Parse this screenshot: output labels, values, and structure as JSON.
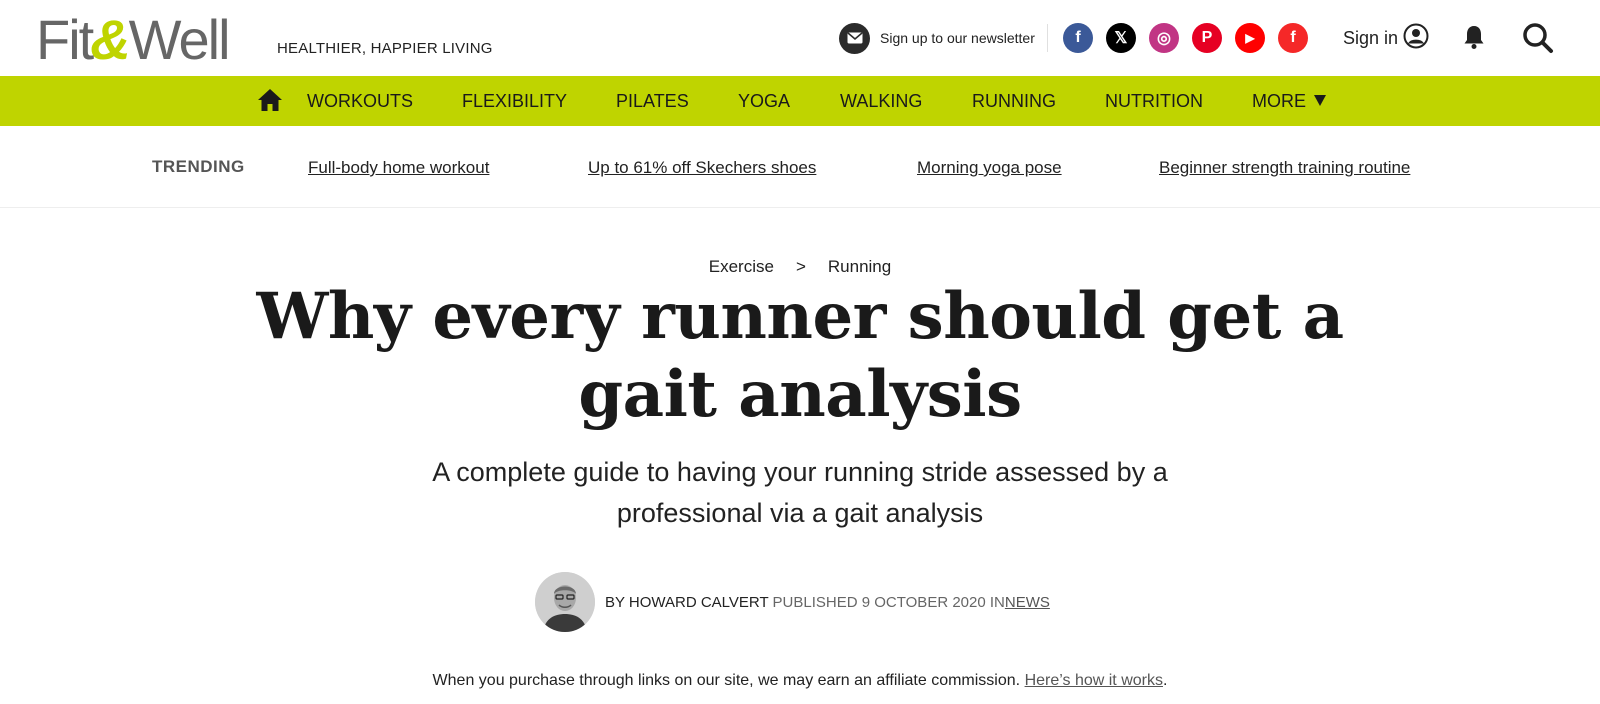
{
  "header": {
    "logo": {
      "part1": "Fit",
      "amp": "&",
      "part2": "Well"
    },
    "tagline": "HEALTHIER, HAPPIER LIVING",
    "newsletter_label": "Sign up to our newsletter",
    "social": [
      {
        "name": "facebook-icon",
        "glyph": "f",
        "color": "#3b5998"
      },
      {
        "name": "x-icon",
        "glyph": "𝕏",
        "color": "#000000"
      },
      {
        "name": "instagram-icon",
        "glyph": "◎",
        "color": "#c13584"
      },
      {
        "name": "pinterest-icon",
        "glyph": "P",
        "color": "#e60023"
      },
      {
        "name": "youtube-icon",
        "glyph": "▶",
        "color": "#ff0000"
      },
      {
        "name": "flipboard-icon",
        "glyph": "f",
        "color": "#f52828"
      }
    ],
    "sign_in_label": "Sign in"
  },
  "nav": {
    "items": [
      "WORKOUTS",
      "FLEXIBILITY",
      "PILATES",
      "YOGA",
      "WALKING",
      "RUNNING",
      "NUTRITION",
      "MORE"
    ],
    "accent": "#bfd400"
  },
  "trending": {
    "label": "TRENDING",
    "links": [
      "Full-body home workout",
      "Up to 61% off Skechers shoes",
      "Morning yoga pose",
      "Beginner strength training routine"
    ]
  },
  "article": {
    "breadcrumb": [
      "Exercise",
      ">",
      "Running"
    ],
    "title": "Why every runner should get a gait analysis",
    "subtitle": "A complete guide to having your running stride assessed by a professional via a gait analysis",
    "byline": {
      "by": "BY HOWARD CALVERT",
      "published": "PUBLISHED 9 OCTOBER 2020",
      "in": "IN",
      "category": "NEWS"
    },
    "disclaimer": "When you purchase through links on our site, we may earn an affiliate commission.",
    "disclaimer_link": "Here’s how it works",
    "disclaimer_end": "."
  }
}
